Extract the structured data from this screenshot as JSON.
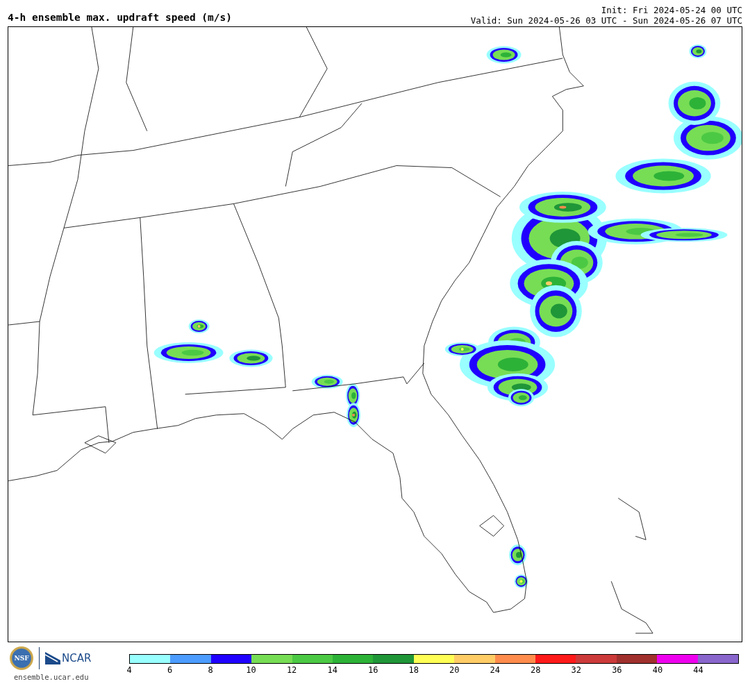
{
  "header": {
    "title": "4-h ensemble max. updraft speed (m/s)",
    "init": "Init: Fri 2024-05-24 00 UTC",
    "valid": "Valid: Sun 2024-05-26 03 UTC - Sun 2024-05-26 07 UTC"
  },
  "footer": {
    "nsf_logo": "NSF",
    "ncar_logo": "NCAR",
    "url": "ensemble.ucar.edu"
  },
  "legend": {
    "bins": [
      {
        "label": "4",
        "color": "#99ffff"
      },
      {
        "label": "6",
        "color": "#4c9cff"
      },
      {
        "label": "8",
        "color": "#2000ff"
      },
      {
        "label": "10",
        "color": "#77dd55"
      },
      {
        "label": "12",
        "color": "#4cc944"
      },
      {
        "label": "14",
        "color": "#2db238"
      },
      {
        "label": "16",
        "color": "#1f9638"
      },
      {
        "label": "18",
        "color": "#ffff55"
      },
      {
        "label": "20",
        "color": "#ffcc66"
      },
      {
        "label": "24",
        "color": "#ff8c4c"
      },
      {
        "label": "28",
        "color": "#ff1a1a"
      },
      {
        "label": "32",
        "color": "#cc3a3a"
      },
      {
        "label": "36",
        "color": "#a0302e"
      },
      {
        "label": "40",
        "color": "#ee00ee"
      },
      {
        "label": "44",
        "color": "#8866cc"
      }
    ]
  }
}
